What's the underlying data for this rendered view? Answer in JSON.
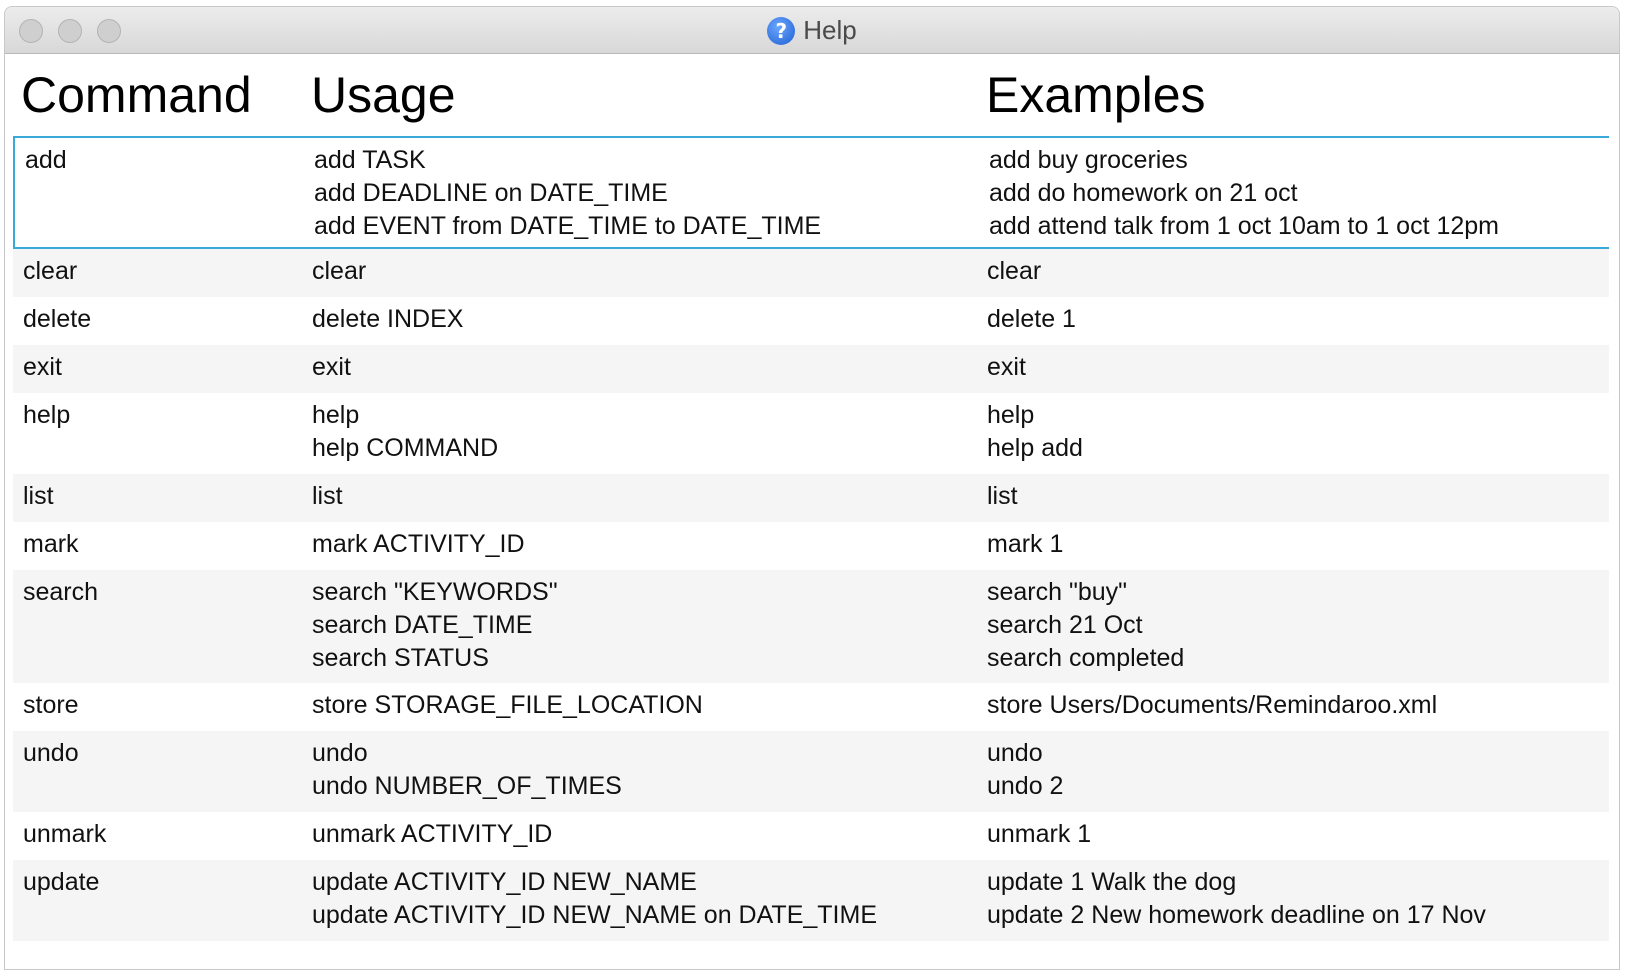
{
  "window": {
    "title": "Help"
  },
  "headers": {
    "command": "Command",
    "usage": "Usage",
    "examples": "Examples"
  },
  "rows": [
    {
      "command": "add",
      "usage": [
        "add TASK",
        "add DEADLINE on DATE_TIME",
        "add EVENT from DATE_TIME to DATE_TIME"
      ],
      "examples": [
        "add buy groceries",
        "add do homework on 21 oct",
        "add attend talk from 1 oct 10am to 1 oct 12pm"
      ]
    },
    {
      "command": "clear",
      "usage": [
        "clear"
      ],
      "examples": [
        "clear"
      ]
    },
    {
      "command": "delete",
      "usage": [
        "delete INDEX"
      ],
      "examples": [
        "delete 1"
      ]
    },
    {
      "command": "exit",
      "usage": [
        "exit"
      ],
      "examples": [
        "exit"
      ]
    },
    {
      "command": "help",
      "usage": [
        "help",
        "help COMMAND"
      ],
      "examples": [
        "help",
        "help add"
      ]
    },
    {
      "command": "list",
      "usage": [
        "list"
      ],
      "examples": [
        "list"
      ]
    },
    {
      "command": "mark",
      "usage": [
        "mark ACTIVITY_ID"
      ],
      "examples": [
        "mark 1"
      ]
    },
    {
      "command": "search",
      "usage": [
        "search \"KEYWORDS\"",
        "search DATE_TIME",
        "search STATUS"
      ],
      "examples": [
        "search \"buy\"",
        "search 21 Oct",
        "search completed"
      ]
    },
    {
      "command": "store",
      "usage": [
        "store STORAGE_FILE_LOCATION"
      ],
      "examples": [
        "store Users/Documents/Remindaroo.xml"
      ]
    },
    {
      "command": "undo",
      "usage": [
        "undo",
        "undo NUMBER_OF_TIMES"
      ],
      "examples": [
        "undo",
        "undo 2"
      ]
    },
    {
      "command": "unmark",
      "usage": [
        "unmark ACTIVITY_ID"
      ],
      "examples": [
        "unmark 1"
      ]
    },
    {
      "command": "update",
      "usage": [
        "update ACTIVITY_ID NEW_NAME",
        "update ACTIVITY_ID NEW_NAME on DATE_TIME"
      ],
      "examples": [
        "update 1 Walk the dog",
        "update 2 New homework deadline on 17 Nov"
      ]
    }
  ],
  "colors": {
    "selection_border": "#3aa8d8",
    "row_alt": "#f5f5f5",
    "help_icon": "#1f5fd1"
  }
}
